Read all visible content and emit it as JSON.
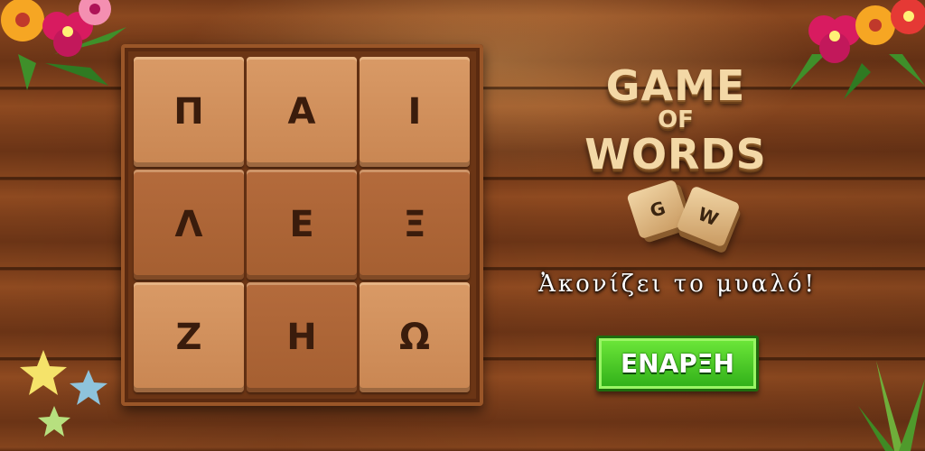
{
  "board": {
    "tiles": [
      {
        "letter": "Π",
        "shade": "light"
      },
      {
        "letter": "Α",
        "shade": "light"
      },
      {
        "letter": "Ι",
        "shade": "light"
      },
      {
        "letter": "Λ",
        "shade": "dark"
      },
      {
        "letter": "Ε",
        "shade": "dark"
      },
      {
        "letter": "Ξ",
        "shade": "dark"
      },
      {
        "letter": "Ζ",
        "shade": "light"
      },
      {
        "letter": "Η",
        "shade": "dark"
      },
      {
        "letter": "Ω",
        "shade": "light"
      }
    ]
  },
  "logo": {
    "line1": "GAME",
    "line2": "OF",
    "line3": "WORDS",
    "dice": [
      "G",
      "W"
    ]
  },
  "tagline": "Ἀκονίζει το μυαλό!",
  "start_button": {
    "label": "ΕΝΑΡΞΗ"
  },
  "colors": {
    "wood": "#7a3d1a",
    "tile_light": "#d99a66",
    "tile_dark": "#b46b3c",
    "button_green": "#4fd12a",
    "logo_cream": "#f3d8a6"
  },
  "decorations": {
    "top_left": "hibiscus-flowers-icon",
    "top_right": "hibiscus-flowers-icon",
    "bottom_left": "stars-icon",
    "bottom_right": "palm-leaves-icon"
  }
}
